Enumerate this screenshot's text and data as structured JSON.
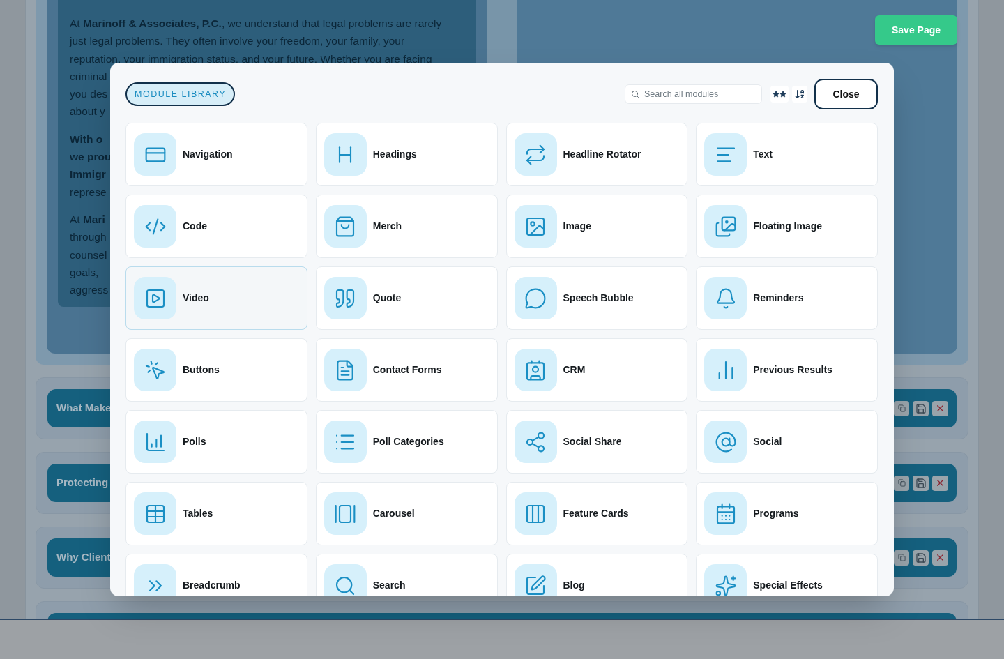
{
  "page": {
    "save_button": "Save Page",
    "intro_paragraphs": [
      {
        "lines": [
          "At **Marinoff & Associates, P.C.**, we understand that legal problems are rarely",
          "just legal problems. They often involve your freedom, your family, your",
          "reputation, your immigration status, and your future. Whether you are facing",
          "criminal",
          "you des",
          "about y"
        ]
      },
      {
        "lines": [
          "**With o**",
          "**we prou**",
          "**Immigr**",
          "represe"
        ]
      },
      {
        "lines": [
          "At **Mari**",
          "through",
          "counsel",
          "goals,",
          "aggress"
        ]
      }
    ],
    "sections": [
      {
        "title": "What Make"
      },
      {
        "title": "Protecting"
      },
      {
        "title": "Why Client"
      }
    ]
  },
  "module_library": {
    "title": "MODULE LIBRARY",
    "search": {
      "placeholder": "Search all modules"
    },
    "close_button": "Close",
    "modules": [
      {
        "label": "Navigation",
        "selected": false
      },
      {
        "label": "Headings",
        "selected": false
      },
      {
        "label": "Headline Rotator",
        "selected": false
      },
      {
        "label": "Text",
        "selected": false
      },
      {
        "label": "Code",
        "selected": false
      },
      {
        "label": "Merch",
        "selected": false
      },
      {
        "label": "Image",
        "selected": false
      },
      {
        "label": "Floating Image",
        "selected": false
      },
      {
        "label": "Video",
        "selected": true
      },
      {
        "label": "Quote",
        "selected": false
      },
      {
        "label": "Speech Bubble",
        "selected": false
      },
      {
        "label": "Reminders",
        "selected": false
      },
      {
        "label": "Buttons",
        "selected": false
      },
      {
        "label": "Contact Forms",
        "selected": false
      },
      {
        "label": "CRM",
        "selected": false
      },
      {
        "label": "Previous Results",
        "selected": false
      },
      {
        "label": "Polls",
        "selected": false
      },
      {
        "label": "Poll Categories",
        "selected": false
      },
      {
        "label": "Social Share",
        "selected": false
      },
      {
        "label": "Social",
        "selected": false
      },
      {
        "label": "Tables",
        "selected": false
      },
      {
        "label": "Carousel",
        "selected": false
      },
      {
        "label": "Feature Cards",
        "selected": false
      },
      {
        "label": "Programs",
        "selected": false
      },
      {
        "label": "Breadcrumb",
        "selected": false
      },
      {
        "label": "Search",
        "selected": false
      },
      {
        "label": "Blog",
        "selected": false
      },
      {
        "label": "Special Effects",
        "selected": false
      }
    ]
  }
}
